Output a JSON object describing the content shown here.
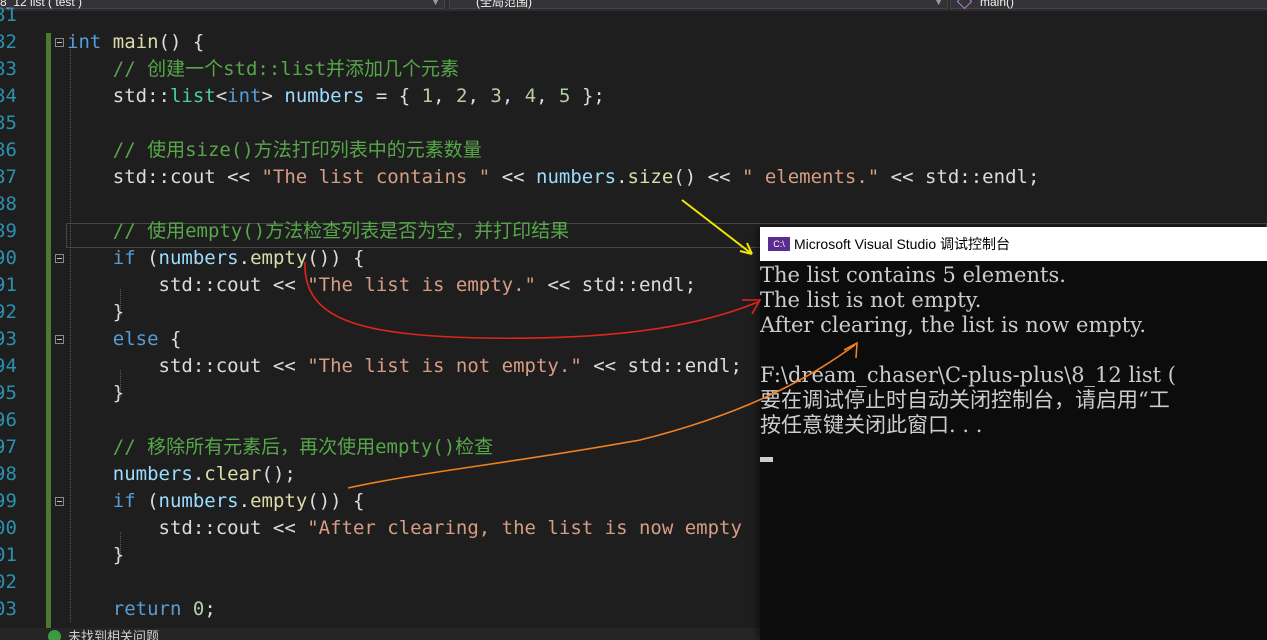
{
  "navbar": {
    "project": "8_12 list ( test )",
    "scope": "(全局范围)",
    "function": "main()"
  },
  "editor": {
    "lines": [
      {
        "n": "81",
        "tokens": []
      },
      {
        "n": "82",
        "fold": true,
        "tokens": [
          {
            "c": "kw",
            "t": "int"
          },
          {
            "c": "fn",
            "t": " main"
          },
          {
            "c": "",
            "t": "() {"
          }
        ]
      },
      {
        "n": "83",
        "tokens": [
          {
            "c": "",
            "t": "    "
          },
          {
            "c": "cm",
            "t": "// 创建一个std::list并添加几个元素"
          }
        ]
      },
      {
        "n": "84",
        "tokens": [
          {
            "c": "",
            "t": "    std::"
          },
          {
            "c": "ty",
            "t": "list"
          },
          {
            "c": "",
            "t": "<"
          },
          {
            "c": "kw",
            "t": "int"
          },
          {
            "c": "",
            "t": "> "
          },
          {
            "c": "var",
            "t": "numbers"
          },
          {
            "c": "",
            "t": " = { "
          },
          {
            "c": "nu",
            "t": "1"
          },
          {
            "c": "",
            "t": ", "
          },
          {
            "c": "nu",
            "t": "2"
          },
          {
            "c": "",
            "t": ", "
          },
          {
            "c": "nu",
            "t": "3"
          },
          {
            "c": "",
            "t": ", "
          },
          {
            "c": "nu",
            "t": "4"
          },
          {
            "c": "",
            "t": ", "
          },
          {
            "c": "nu",
            "t": "5"
          },
          {
            "c": "",
            "t": " };"
          }
        ]
      },
      {
        "n": "85",
        "tokens": []
      },
      {
        "n": "86",
        "tokens": [
          {
            "c": "",
            "t": "    "
          },
          {
            "c": "cm",
            "t": "// 使用size()方法打印列表中的元素数量"
          }
        ]
      },
      {
        "n": "87",
        "tokens": [
          {
            "c": "",
            "t": "    std::cout << "
          },
          {
            "c": "st",
            "t": "\"The list contains \""
          },
          {
            "c": "",
            "t": " << "
          },
          {
            "c": "var",
            "t": "numbers"
          },
          {
            "c": "",
            "t": "."
          },
          {
            "c": "fn",
            "t": "size"
          },
          {
            "c": "",
            "t": "() << "
          },
          {
            "c": "st",
            "t": "\" elements.\""
          },
          {
            "c": "",
            "t": " << std::endl;"
          }
        ]
      },
      {
        "n": "88",
        "tokens": []
      },
      {
        "n": "89",
        "tokens": [
          {
            "c": "",
            "t": "    "
          },
          {
            "c": "cm",
            "t": "// 使用empty()方法检查列表是否为空，并打印结果"
          }
        ]
      },
      {
        "n": "90",
        "fold": true,
        "tokens": [
          {
            "c": "",
            "t": "    "
          },
          {
            "c": "kw",
            "t": "if"
          },
          {
            "c": "",
            "t": " ("
          },
          {
            "c": "var",
            "t": "numbers"
          },
          {
            "c": "",
            "t": "."
          },
          {
            "c": "fn",
            "t": "empty"
          },
          {
            "c": "",
            "t": "()) {"
          }
        ]
      },
      {
        "n": "91",
        "tokens": [
          {
            "c": "",
            "t": "        std::cout << "
          },
          {
            "c": "st",
            "t": "\"The list is empty.\""
          },
          {
            "c": "",
            "t": " << std::endl;"
          }
        ]
      },
      {
        "n": "92",
        "tokens": [
          {
            "c": "",
            "t": "    }"
          }
        ]
      },
      {
        "n": "93",
        "fold": true,
        "tokens": [
          {
            "c": "",
            "t": "    "
          },
          {
            "c": "kw",
            "t": "else"
          },
          {
            "c": "",
            "t": " {"
          }
        ]
      },
      {
        "n": "94",
        "tokens": [
          {
            "c": "",
            "t": "        std::cout << "
          },
          {
            "c": "st",
            "t": "\"The list is not empty.\""
          },
          {
            "c": "",
            "t": " << std::endl;"
          }
        ]
      },
      {
        "n": "95",
        "tokens": [
          {
            "c": "",
            "t": "    }"
          }
        ]
      },
      {
        "n": "96",
        "tokens": []
      },
      {
        "n": "97",
        "tokens": [
          {
            "c": "",
            "t": "    "
          },
          {
            "c": "cm",
            "t": "// 移除所有元素后，再次使用empty()检查"
          }
        ]
      },
      {
        "n": "98",
        "tokens": [
          {
            "c": "",
            "t": "    "
          },
          {
            "c": "var",
            "t": "numbers"
          },
          {
            "c": "",
            "t": "."
          },
          {
            "c": "fn",
            "t": "clear"
          },
          {
            "c": "",
            "t": "();"
          }
        ]
      },
      {
        "n": "99",
        "fold": true,
        "tokens": [
          {
            "c": "",
            "t": "    "
          },
          {
            "c": "kw",
            "t": "if"
          },
          {
            "c": "",
            "t": " ("
          },
          {
            "c": "var",
            "t": "numbers"
          },
          {
            "c": "",
            "t": "."
          },
          {
            "c": "fn",
            "t": "empty"
          },
          {
            "c": "",
            "t": "()) {"
          }
        ]
      },
      {
        "n": "00",
        "tokens": [
          {
            "c": "",
            "t": "        std::cout << "
          },
          {
            "c": "st",
            "t": "\"After clearing, the list is now empty"
          }
        ]
      },
      {
        "n": "01",
        "tokens": [
          {
            "c": "",
            "t": "    }"
          }
        ]
      },
      {
        "n": "02",
        "tokens": []
      },
      {
        "n": "03",
        "tokens": [
          {
            "c": "",
            "t": "    "
          },
          {
            "c": "kw",
            "t": "return"
          },
          {
            "c": "",
            "t": " "
          },
          {
            "c": "nu",
            "t": "0"
          },
          {
            "c": "",
            "t": ";"
          }
        ]
      }
    ]
  },
  "console": {
    "icon_text": "C:\\",
    "title": "Microsoft Visual Studio 调试控制台",
    "lines": [
      "The list contains 5 elements.",
      "The list is not empty.",
      "After clearing, the list is now empty.",
      "",
      "F:\\dream_chaser\\C-plus-plus\\8_12 list (",
      "要在调试停止时自动关闭控制台，请启用“工",
      "按任意键关闭此窗口. . ."
    ]
  },
  "statusbar": {
    "text": "未找到相关问题"
  },
  "colors": {
    "editor_bg": "#1e1e1e",
    "keyword": "#569cd6",
    "comment": "#57a64a",
    "string": "#d69d85",
    "function": "#dcdcaa",
    "variable": "#9cdcfe",
    "arrow_yellow": "#f2e600",
    "arrow_red": "#e0251b",
    "arrow_orange": "#f08020"
  }
}
